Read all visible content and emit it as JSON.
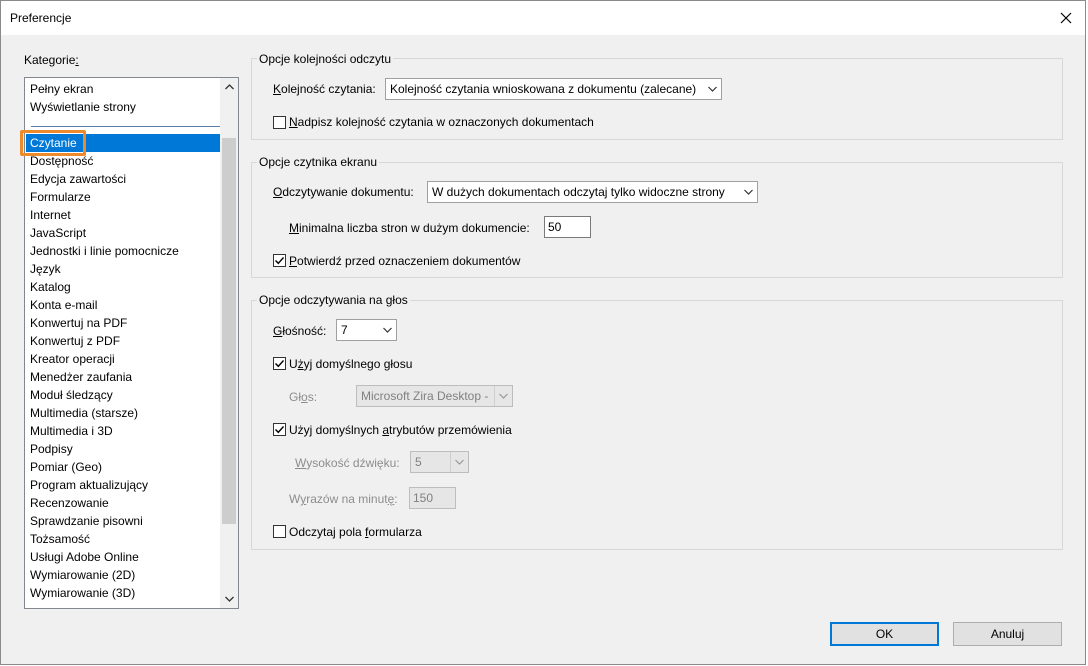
{
  "dialog": {
    "title": "Preferencje"
  },
  "categories": {
    "label": "Kategorie:",
    "items_top": [
      "Pełny ekran",
      "Wyświetlanie strony"
    ],
    "items": [
      "Czytanie",
      "Dostępność",
      "Edycja zawartości",
      "Formularze",
      "Internet",
      "JavaScript",
      "Jednostki i linie pomocnicze",
      "Język",
      "Katalog",
      "Konta e-mail",
      "Konwertuj na PDF",
      "Konwertuj z PDF",
      "Kreator operacji",
      "Menedżer zaufania",
      "Moduł śledzący",
      "Multimedia (starsze)",
      "Multimedia i 3D",
      "Podpisy",
      "Pomiar (Geo)",
      "Program aktualizujący",
      "Recenzowanie",
      "Sprawdzanie pisowni",
      "Tożsamość",
      "Usługi Adobe Online",
      "Wymiarowanie (2D)",
      "Wymiarowanie (3D)"
    ],
    "selected": "Czytanie"
  },
  "reading_order": {
    "legend": "Opcje kolejności odczytu",
    "order_label": "Kolejność czytania:",
    "order_value": "Kolejność czytania wnioskowana z dokumentu (zalecane)",
    "override_label": "Nadpisz kolejność czytania w oznaczonych dokumentach",
    "override_checked": false
  },
  "screen_reader": {
    "legend": "Opcje czytnika ekranu",
    "reading_label": "Odczytywanie dokumentu:",
    "reading_value": "W dużych dokumentach odczytaj tylko widoczne strony",
    "min_pages_label": "Minimalna liczba stron w dużym dokumencie:",
    "min_pages_value": "50",
    "confirm_label": "Potwierdź przed oznaczeniem dokumentów",
    "confirm_checked": true
  },
  "read_aloud": {
    "legend": "Opcje odczytywania na głos",
    "volume_label": "Głośność:",
    "volume_value": "7",
    "default_voice_label": "Użyj domyślnego głosu",
    "default_voice_checked": true,
    "voice_label": "Głos:",
    "voice_value": "Microsoft Zira Desktop -",
    "default_attrs_label": "Użyj domyślnych atrybutów przemówienia",
    "default_attrs_checked": true,
    "pitch_label": "Wysokość dźwięku:",
    "pitch_value": "5",
    "wpm_label": "Wyrazów na minutę:",
    "wpm_value": "150",
    "form_fields_label": "Odczytaj pola formularza",
    "form_fields_checked": false
  },
  "buttons": {
    "ok": "OK",
    "cancel": "Anuluj"
  },
  "colors": {
    "selection": "#0078d7",
    "callout": "#ec8a2c",
    "dialog_bg": "#f0f0f0"
  }
}
